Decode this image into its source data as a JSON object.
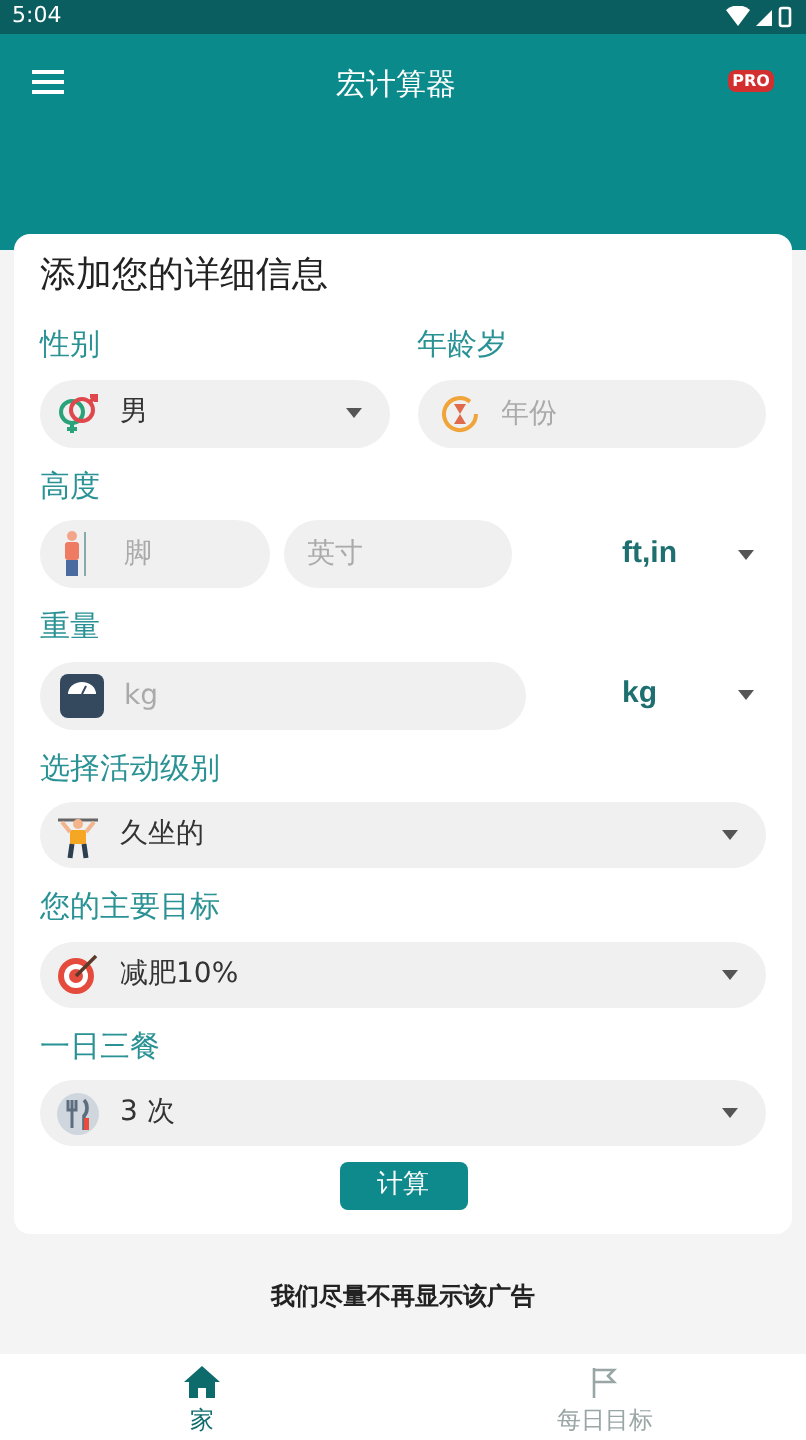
{
  "status_bar": {
    "time": "5:04"
  },
  "app_bar": {
    "title": "宏计算器",
    "badge": "PRO"
  },
  "form": {
    "title": "添加您的详细信息",
    "gender": {
      "label": "性别",
      "value": "男"
    },
    "age": {
      "label": "年龄岁",
      "placeholder": "年份"
    },
    "height": {
      "label": "高度",
      "feet_placeholder": "脚",
      "inches_placeholder": "英寸",
      "unit": "ft,in"
    },
    "weight": {
      "label": "重量",
      "placeholder": "kg",
      "unit": "kg"
    },
    "activity": {
      "label": "选择活动级别",
      "value": "久坐的"
    },
    "goal": {
      "label": "您的主要目标",
      "value": "减肥10%"
    },
    "meals": {
      "label": "一日三餐",
      "value": "3 次"
    },
    "button": "计算"
  },
  "ad": {
    "text": "我们尽量不再显示该广告"
  },
  "bottom_nav": [
    {
      "label": "家",
      "kind": "home",
      "selected": true
    },
    {
      "label": "每日目标",
      "kind": "flag",
      "selected": false
    }
  ]
}
